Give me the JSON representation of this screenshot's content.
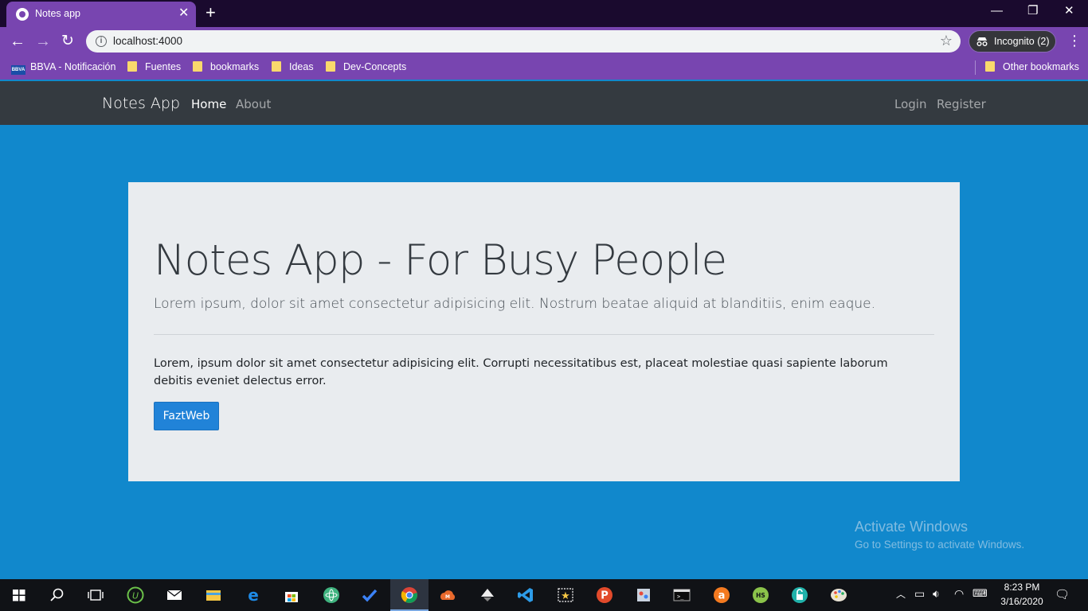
{
  "browser": {
    "tab_title": "Notes app",
    "url": "localhost:4000",
    "profile_label": "Incognito (2)",
    "bookmarks": [
      {
        "label": "BBVA - Notificación",
        "icon": "bbva-icon"
      },
      {
        "label": "Fuentes",
        "icon": "folder-icon"
      },
      {
        "label": "bookmarks",
        "icon": "folder-icon"
      },
      {
        "label": "Ideas",
        "icon": "folder-icon"
      },
      {
        "label": "Dev-Concepts",
        "icon": "folder-icon"
      }
    ],
    "other_bookmarks": "Other bookmarks"
  },
  "site": {
    "brand": "Notes App",
    "nav": {
      "home": "Home",
      "about": "About",
      "login": "Login",
      "register": "Register"
    },
    "hero": {
      "title": "Notes App - For Busy People",
      "lead": "Lorem ipsum, dolor sit amet consectetur adipisicing elit. Nostrum beatae aliquid at blanditiis, enim eaque.",
      "body": "Lorem, ipsum dolor sit amet consectetur adipisicing elit. Corrupti necessitatibus est, placeat molestiae quasi sapiente laborum debitis eveniet delectus error.",
      "button": "FaztWeb"
    }
  },
  "watermark": {
    "title": "Activate Windows",
    "subtitle": "Go to Settings to activate Windows."
  },
  "taskbar": {
    "apps": [
      "start-icon",
      "search-icon",
      "task-view-icon",
      "utorrent-icon",
      "mail-icon",
      "file-explorer-icon",
      "edge-icon",
      "store-icon",
      "atom-icon",
      "todo-icon",
      "chrome-icon",
      "cloud-app-icon",
      "inkscape-icon",
      "vscode-icon",
      "screenshot-icon",
      "psiphon-icon",
      "paint-icon",
      "terminal-icon",
      "avast-icon",
      "hotspot-icon",
      "vpn-icon",
      "paint-palette-icon"
    ],
    "time": "8:23 PM",
    "date": "3/16/2020"
  },
  "colors": {
    "page_bg": "#1188cc",
    "navbar_bg": "#343a40",
    "jumbotron_bg": "#e9ecef",
    "button_bg": "#2183d8",
    "browser_accent": "#7845b0"
  }
}
